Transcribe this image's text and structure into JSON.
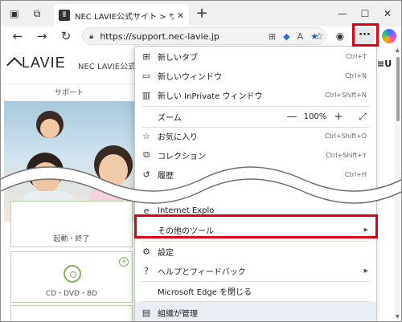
{
  "browser": {
    "tab_title": "NEC LAVIE公式サイト > サービス&サ",
    "tab_favicon": "Ⅱ",
    "address_url": "https://support.nec-lavie.jp",
    "more_button_label": "···"
  },
  "page": {
    "logo_text": "LAVIE",
    "site_name": "NEC LAVIE公式サ",
    "sub_nav": "サポート",
    "right_char": "≡U",
    "categories": [
      {
        "label": "起動・終了"
      },
      {
        "label": "CD・DVD・BD"
      }
    ]
  },
  "menu": {
    "items_top": [
      {
        "icon": "new-tab-icon",
        "label": "新しいタブ",
        "shortcut": "Ctrl+T"
      },
      {
        "icon": "new-window-icon",
        "label": "新しいウィンドウ",
        "shortcut": "Ctrl+N"
      },
      {
        "icon": "inprivate-icon",
        "label": "新しい InPrivate ウィンドウ",
        "shortcut": "Ctrl+Shift+N"
      }
    ],
    "zoom": {
      "label": "ズーム",
      "minus": "—",
      "value": "100%",
      "plus": "+",
      "fullscreen": "⤢"
    },
    "items_mid": [
      {
        "icon": "favorites-icon",
        "label": "お気に入り",
        "shortcut": "Ctrl+Shift+O"
      },
      {
        "icon": "collections-icon",
        "label": "コレクション",
        "shortcut": "Ctrl+Shift+Y"
      },
      {
        "icon": "history-icon",
        "label": "履歴",
        "shortcut": "Ctrl+H"
      }
    ],
    "ie_mode": {
      "label": "Internet Explo"
    },
    "more_tools": {
      "label": "その他のツール"
    },
    "settings": {
      "label": "設定"
    },
    "help": {
      "label": "ヘルプとフィードバック"
    },
    "close_edge": {
      "label": "Microsoft Edge を閉じる"
    },
    "managed": {
      "label": "組織が管理"
    }
  },
  "colors": {
    "highlight": "#e00014",
    "accent_green": "#7fb35f"
  }
}
